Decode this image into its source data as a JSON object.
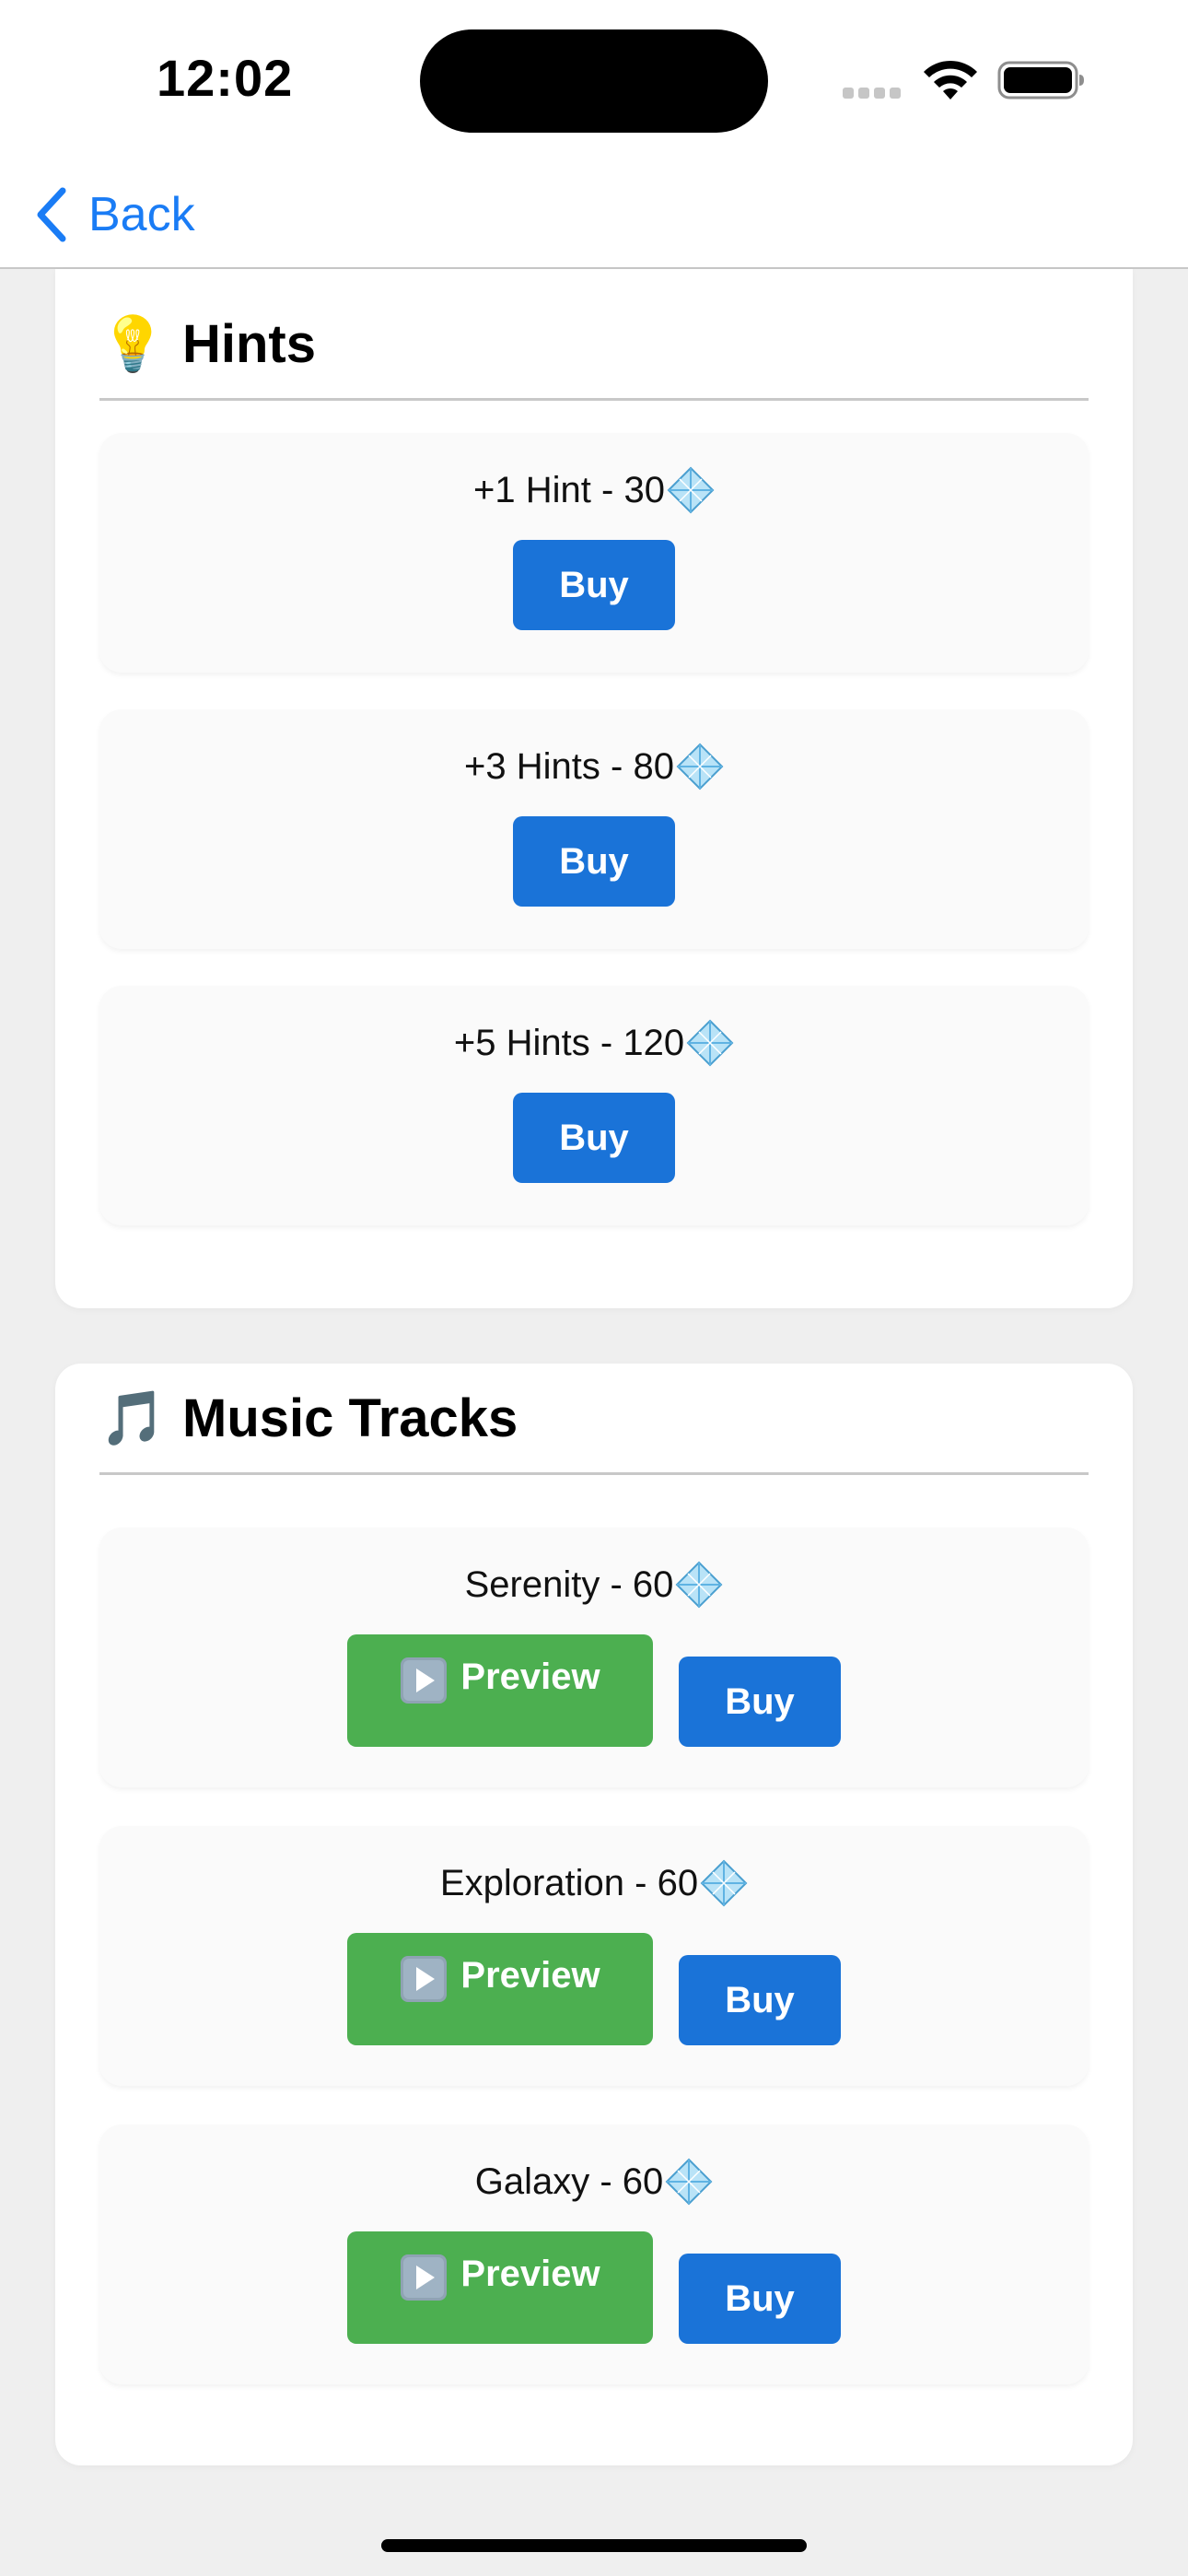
{
  "status_bar": {
    "time": "12:02"
  },
  "nav": {
    "back_label": "Back"
  },
  "colors": {
    "accent": "#1a7cf5",
    "buy_button": "#1a73d8",
    "preview_button": "#4caf50",
    "background": "#efefef"
  },
  "hints": {
    "emoji": "💡",
    "title": "Hints",
    "items": [
      {
        "label": "+1 Hint - 30",
        "buy_label": "Buy"
      },
      {
        "label": "+3 Hints - 80",
        "buy_label": "Buy"
      },
      {
        "label": "+5 Hints - 120",
        "buy_label": "Buy"
      }
    ]
  },
  "music": {
    "emoji": "🎵",
    "title": "Music Tracks",
    "items": [
      {
        "label": "Serenity - 60",
        "preview_label": "Preview",
        "buy_label": "Buy"
      },
      {
        "label": "Exploration - 60",
        "preview_label": "Preview",
        "buy_label": "Buy"
      },
      {
        "label": "Galaxy - 60",
        "preview_label": "Preview",
        "buy_label": "Buy"
      }
    ]
  },
  "icons": {
    "currency": "gem-icon",
    "preview": "play-icon"
  }
}
